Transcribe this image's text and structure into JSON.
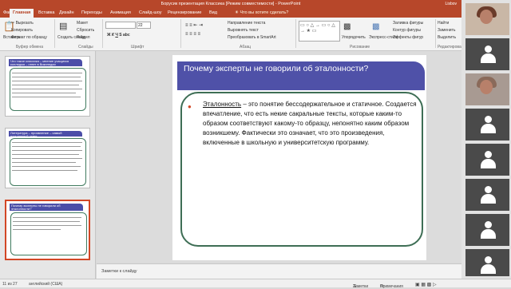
{
  "window": {
    "title": "Борусик презентация Классика [Режим совместимости] - PowerPoint",
    "user": "Lisbov"
  },
  "tabs": [
    "Файл",
    "Главная",
    "Вставка",
    "Дизайн",
    "Переходы",
    "Анимация",
    "Слайд-шоу",
    "Рецензирование",
    "Вид"
  ],
  "tell_me": "Что вы хотите сделать?",
  "ribbon": {
    "clipboard": {
      "paste": "Вставить",
      "cut": "Вырезать",
      "copy": "Копировать",
      "format": "Формат по образцу",
      "group": "Буфер обмена"
    },
    "slides": {
      "new": "Создать слайд",
      "layout": "Макет",
      "reset": "Сбросить",
      "section": "Раздел",
      "group": "Слайды"
    },
    "font": {
      "size": "22",
      "group": "Шрифт"
    },
    "paragraph": {
      "dir": "Направление текста",
      "align": "Выровнять текст",
      "smartart": "Преобразовать в SmartArt",
      "group": "Абзац"
    },
    "drawing": {
      "arrange": "Упорядочить",
      "styles": "Экспресс-стили",
      "fill": "Заливка фигуры",
      "outline": "Контур фигуры",
      "effects": "Эффекты фигур",
      "group": "Рисование"
    },
    "editing": {
      "find": "Найти",
      "replace": "Заменить",
      "select": "Выделить",
      "group": "Редактирование"
    }
  },
  "thumbnails": [
    {
      "num": "",
      "title": "Что такое классика – мнение учащихся колледжа – ответ в Википедии"
    },
    {
      "num": "",
      "title": "Литература – проявление – самый популярный ответ"
    },
    {
      "num": "",
      "title": "Почему эксперты не говорили об эталонности?"
    }
  ],
  "slide": {
    "title": "Почему эксперты не говорили об эталонности?",
    "term": "Эталонность",
    "body": " – это понятие бессодержательное и статичное. Создается впечатление, что есть некие сакральные тексты, которые каким-то образом соответствуют какому-то образцу, непонятно каким образом возникшему. Фактически это означает, что это произведения, включенные в школьную и университетскую программу."
  },
  "notes_placeholder": "Заметки к слайду",
  "status": {
    "slide_num": "11 из 27",
    "lang": "английский (США)",
    "notes": "Заметки",
    "comments": "Примечания"
  }
}
